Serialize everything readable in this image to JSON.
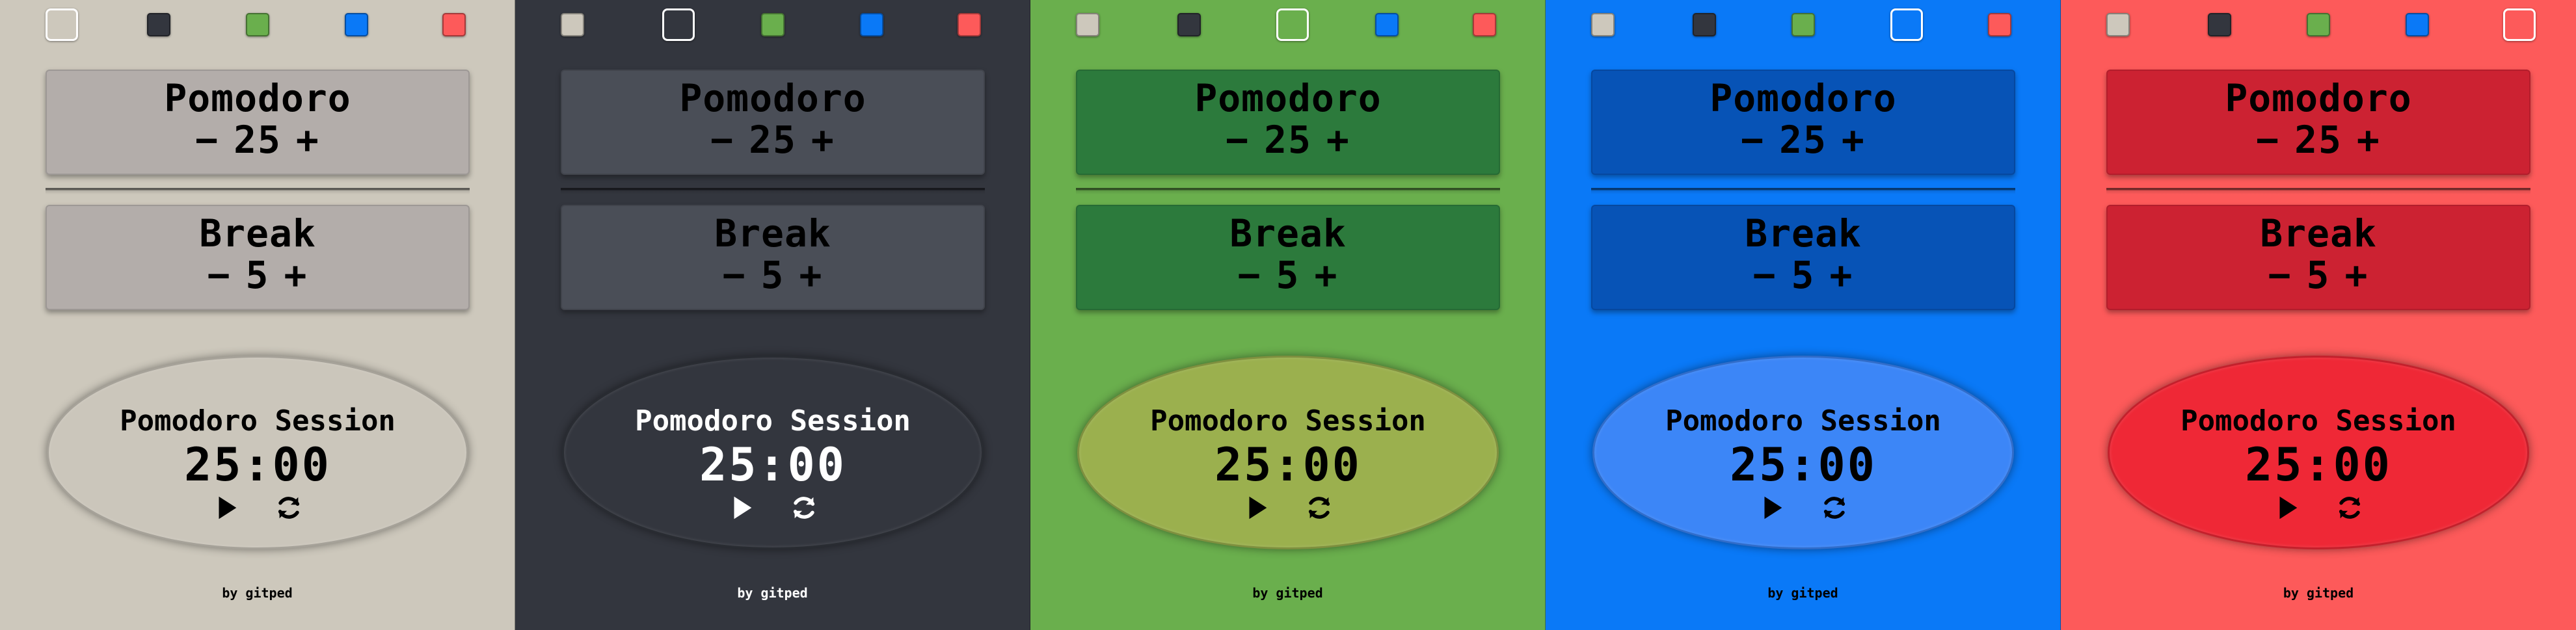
{
  "swatch_colors": [
    "#cdc8bc",
    "#33363e",
    "#6aaf4d",
    "#0a79f7",
    "#fd5a5a"
  ],
  "panels": [
    {
      "theme": "beige",
      "background": "#cdc8bc",
      "card_bg": "#b3adaa",
      "oval_bg": "#cbc6bb",
      "text_color": "#000000",
      "active_swatch": 0,
      "work": {
        "title": "Pomodoro",
        "minus": "−",
        "value": "25",
        "plus": "+"
      },
      "break": {
        "title": "Break",
        "minus": "−",
        "value": "5",
        "plus": "+"
      },
      "session": {
        "label": "Pomodoro Session",
        "time": "25:00"
      },
      "credit": "by gitped"
    },
    {
      "theme": "dark",
      "background": "#33363e",
      "card_bg": "#4a4e57",
      "oval_bg": "#33363e",
      "text_color": "#000000",
      "session_text_color": "#ffffff",
      "active_swatch": 1,
      "work": {
        "title": "Pomodoro",
        "minus": "−",
        "value": "25",
        "plus": "+"
      },
      "break": {
        "title": "Break",
        "minus": "−",
        "value": "5",
        "plus": "+"
      },
      "session": {
        "label": "Pomodoro Session",
        "time": "25:00"
      },
      "credit": "by gitped"
    },
    {
      "theme": "green",
      "background": "#6aaf4d",
      "card_bg": "#2c7a3c",
      "oval_bg": "#9bb04e",
      "text_color": "#000000",
      "active_swatch": 2,
      "work": {
        "title": "Pomodoro",
        "minus": "−",
        "value": "25",
        "plus": "+"
      },
      "break": {
        "title": "Break",
        "minus": "−",
        "value": "5",
        "plus": "+"
      },
      "session": {
        "label": "Pomodoro Session",
        "time": "25:00"
      },
      "credit": "by gitped"
    },
    {
      "theme": "blue",
      "background": "#0a79f7",
      "card_bg": "#0753b6",
      "oval_bg": "#3c86f7",
      "text_color": "#000000",
      "active_swatch": 3,
      "work": {
        "title": "Pomodoro",
        "minus": "−",
        "value": "25",
        "plus": "+"
      },
      "break": {
        "title": "Break",
        "minus": "−",
        "value": "5",
        "plus": "+"
      },
      "session": {
        "label": "Pomodoro Session",
        "time": "25:00"
      },
      "credit": "by gitped"
    },
    {
      "theme": "red",
      "background": "#fd5a5a",
      "card_bg": "#cc2232",
      "oval_bg": "#ef2836",
      "text_color": "#000000",
      "active_swatch": 4,
      "work": {
        "title": "Pomodoro",
        "minus": "−",
        "value": "25",
        "plus": "+"
      },
      "break": {
        "title": "Break",
        "minus": "−",
        "value": "5",
        "plus": "+"
      },
      "session": {
        "label": "Pomodoro Session",
        "time": "25:00"
      },
      "credit": "by gitped"
    }
  ],
  "icons": {
    "play": "play-icon",
    "reset": "refresh-icon"
  }
}
